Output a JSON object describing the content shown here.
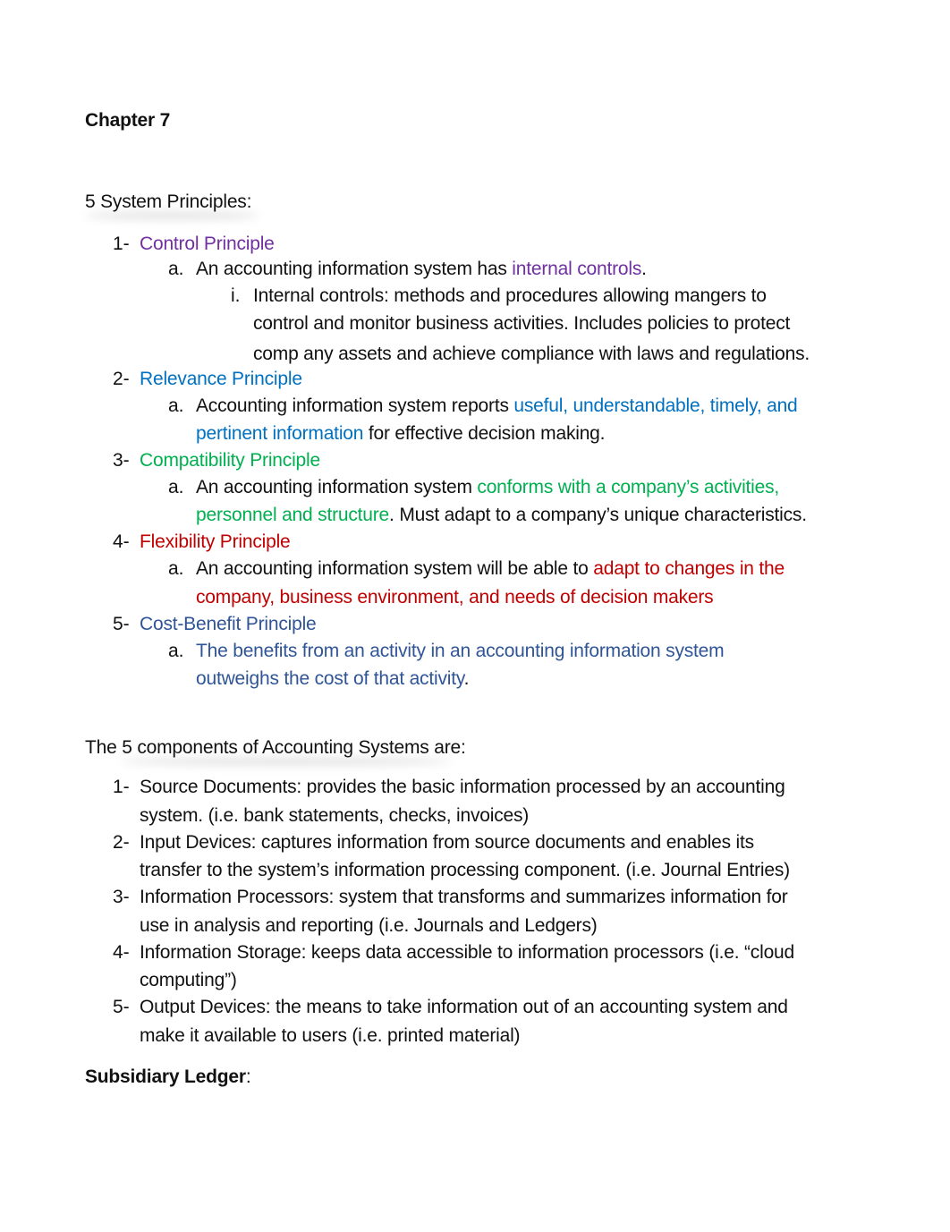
{
  "document": {
    "title": "Chapter 7",
    "colors": {
      "control": "#7030A0",
      "relevance": "#0070C0",
      "compatibility": "#00B050",
      "flexibility": "#C00000",
      "cost_benefit": "#2F5597"
    },
    "principles_heading": "5 System Principles:",
    "principles": [
      {
        "marker": "1-",
        "title": "Control Principle",
        "sub": {
          "marker": "a.",
          "line1_plain": "An accounting information system has ",
          "line1_colored": "internal controls",
          "line1_end": ".",
          "subsub": {
            "marker": "i.",
            "line1": "Internal controls: methods and procedures allowing mangers to",
            "line2": "control and monitor business activities. Includes policies to protect",
            "line3": "comp any assets and achieve compliance with laws and regulations."
          }
        }
      },
      {
        "marker": "2-",
        "title": "Relevance Principle",
        "sub": {
          "marker": "a.",
          "line1_plain": "Accounting information system reports ",
          "line1_colored": "useful, understandable, timely, and",
          "line2_colored": "pertinent information",
          "line2_plain": " for effective decision making."
        }
      },
      {
        "marker": "3-",
        "title": "Compatibility Principle",
        "sub": {
          "marker": "a.",
          "line1_plain": "An accounting information system ",
          "line1_colored": "conforms with a company’s activities,",
          "line2_colored": "personnel and structure",
          "line2_plain": ". Must adapt to a company’s unique characteristics."
        }
      },
      {
        "marker": "4-",
        "title": "Flexibility Principle",
        "sub": {
          "marker": "a.",
          "line1_plain": "An accounting information system will be able to ",
          "line1_colored": "adapt to changes in the",
          "line2_colored": "company, business environment, and needs of decision makers"
        }
      },
      {
        "marker": "5-",
        "title": "Cost-Benefit Principle",
        "sub": {
          "marker": "a.",
          "line1_colored": "The benefits from an activity in an accounting information system",
          "line2_colored": "outweighs the cost of that activity",
          "line2_plain": "."
        }
      }
    ],
    "components_heading": "The 5 components of Accounting Systems are:",
    "components": [
      {
        "marker": "1-",
        "line1": "Source Documents: provides the basic information processed by an accounting",
        "line2": "system. (i.e. bank statements, checks, invoices)"
      },
      {
        "marker": "2-",
        "line1": "Input Devices: captures information from source documents and enables its",
        "line2": "transfer to the system’s information processing component. (i.e. Journal Entries)"
      },
      {
        "marker": "3-",
        "line1": "Information Processors: system that transforms and summarizes information for",
        "line2": "use in analysis and reporting (i.e. Journals and Ledgers)"
      },
      {
        "marker": "4-",
        "line1": "Information Storage: keeps data accessible to information processors (i.e. “cloud",
        "line2": "computing”)"
      },
      {
        "marker": "5-",
        "line1": "Output Devices: the means to take information out of an accounting system and",
        "line2": "make it available to users (i.e. printed material)"
      }
    ],
    "subsidiary_heading": "Subsidiary Ledger",
    "subsidiary_colon": ":"
  }
}
